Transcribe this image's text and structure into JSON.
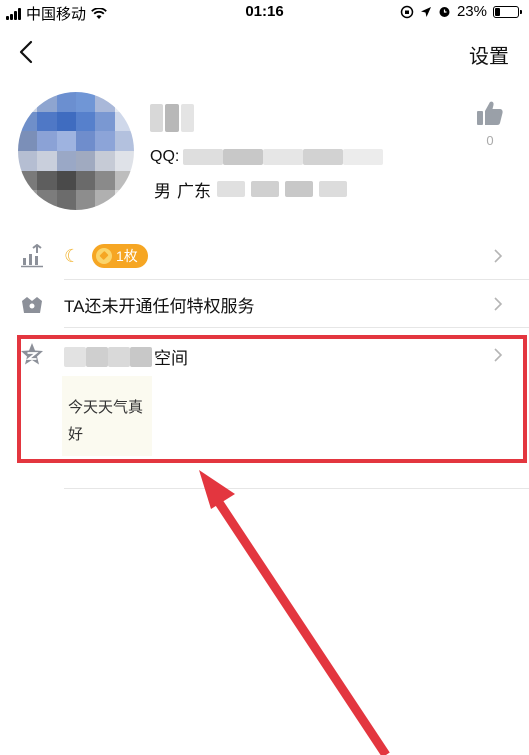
{
  "status_bar": {
    "carrier": "中国移动",
    "time": "01:16",
    "battery": "23%",
    "battery_level": 0.23
  },
  "header": {
    "settings_label": "设置"
  },
  "profile": {
    "qq_prefix": "QQ:",
    "gender": "男",
    "location_prefix": "广东",
    "likes": {
      "count": "0"
    }
  },
  "rows": {
    "level": {
      "badge_text": "1枚"
    },
    "privilege": {
      "label": "TA还未开通任何特权服务"
    },
    "space": {
      "title_suffix": "空间",
      "post_text": "今天天气真好",
      "post_line1": "今天天气真",
      "post_line2": "好"
    }
  },
  "colors": {
    "highlight": "#e3363f",
    "badge": "#f6a623",
    "divider": "#e6e6e6"
  }
}
